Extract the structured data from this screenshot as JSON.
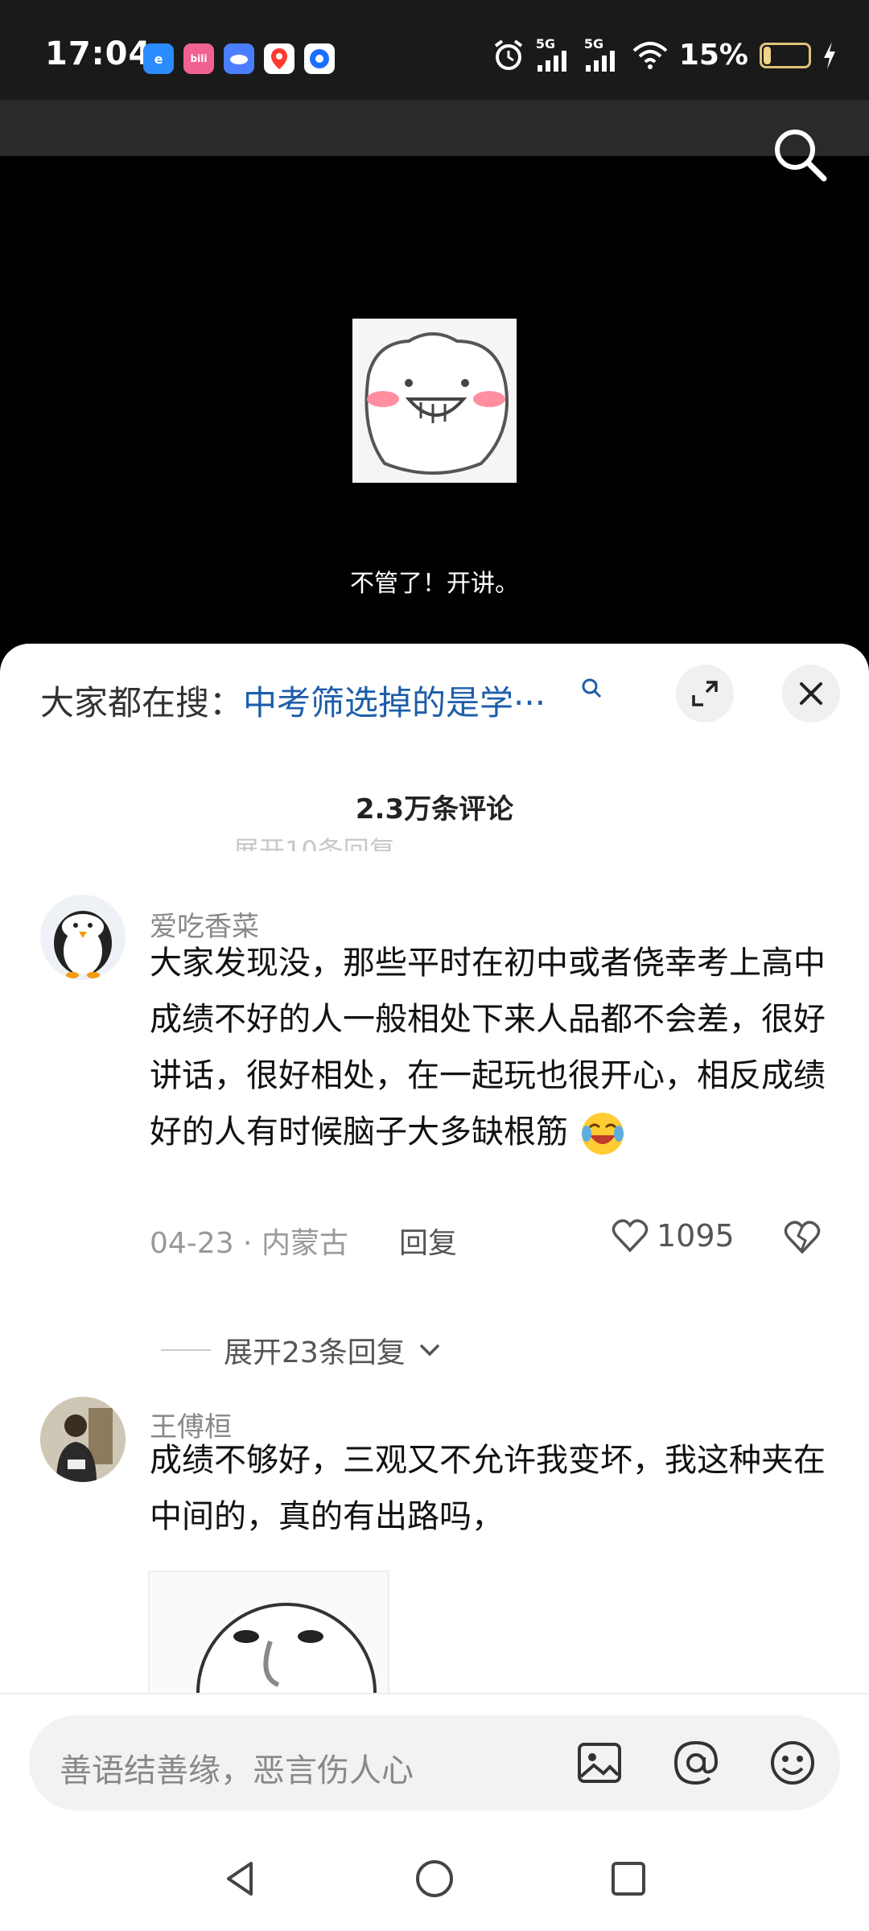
{
  "status_bar": {
    "time": "17:04",
    "apps": [
      {
        "icon": "browser-app-icon",
        "color": "#2a8cff",
        "label": "e"
      },
      {
        "icon": "bilibili-app-icon",
        "color": "#f06292",
        "label": "bili"
      },
      {
        "icon": "cloud-app-icon",
        "color": "#4a7dff",
        "label": ""
      },
      {
        "icon": "map-app-icon",
        "color": "#ff3b30",
        "label": "du"
      },
      {
        "icon": "shield-app-icon",
        "color": "#1a6fff",
        "label": ""
      }
    ],
    "network_1": "5G",
    "network_2": "5G",
    "battery_text": "15%",
    "battery_level": 0.15
  },
  "video": {
    "subtitle": "不管了！开讲。"
  },
  "trending": {
    "label": "大家都在搜：",
    "query": "中考筛选掉的是学···"
  },
  "comments_header": {
    "count_label": "2.3万条评论",
    "ghost_text": "展开10条回复"
  },
  "comments": [
    {
      "username": "爱吃香菜",
      "text": "大家发现没，那些平时在初中或者侥幸考上高中成绩不好的人一般相处下来人品都不会差，很好讲话，很好相处，在一起玩也很开心，相反成绩好的人有时候脑子大多缺根筋",
      "date_location": "04-23 · 内蒙古",
      "reply_label": "回复",
      "likes": "1095",
      "expand_label": "展开23条回复"
    },
    {
      "username": "王傅桓",
      "text": "成绩不够好，三观又不允许我变坏，我这种夹在中间的，真的有出路吗，"
    }
  ],
  "input": {
    "placeholder": "善语结善缘，恶言伤人心"
  },
  "colors": {
    "accent_link": "#1d5eaa",
    "sheet_bg": "#ffffff",
    "battery_color": "#f1d28a"
  }
}
